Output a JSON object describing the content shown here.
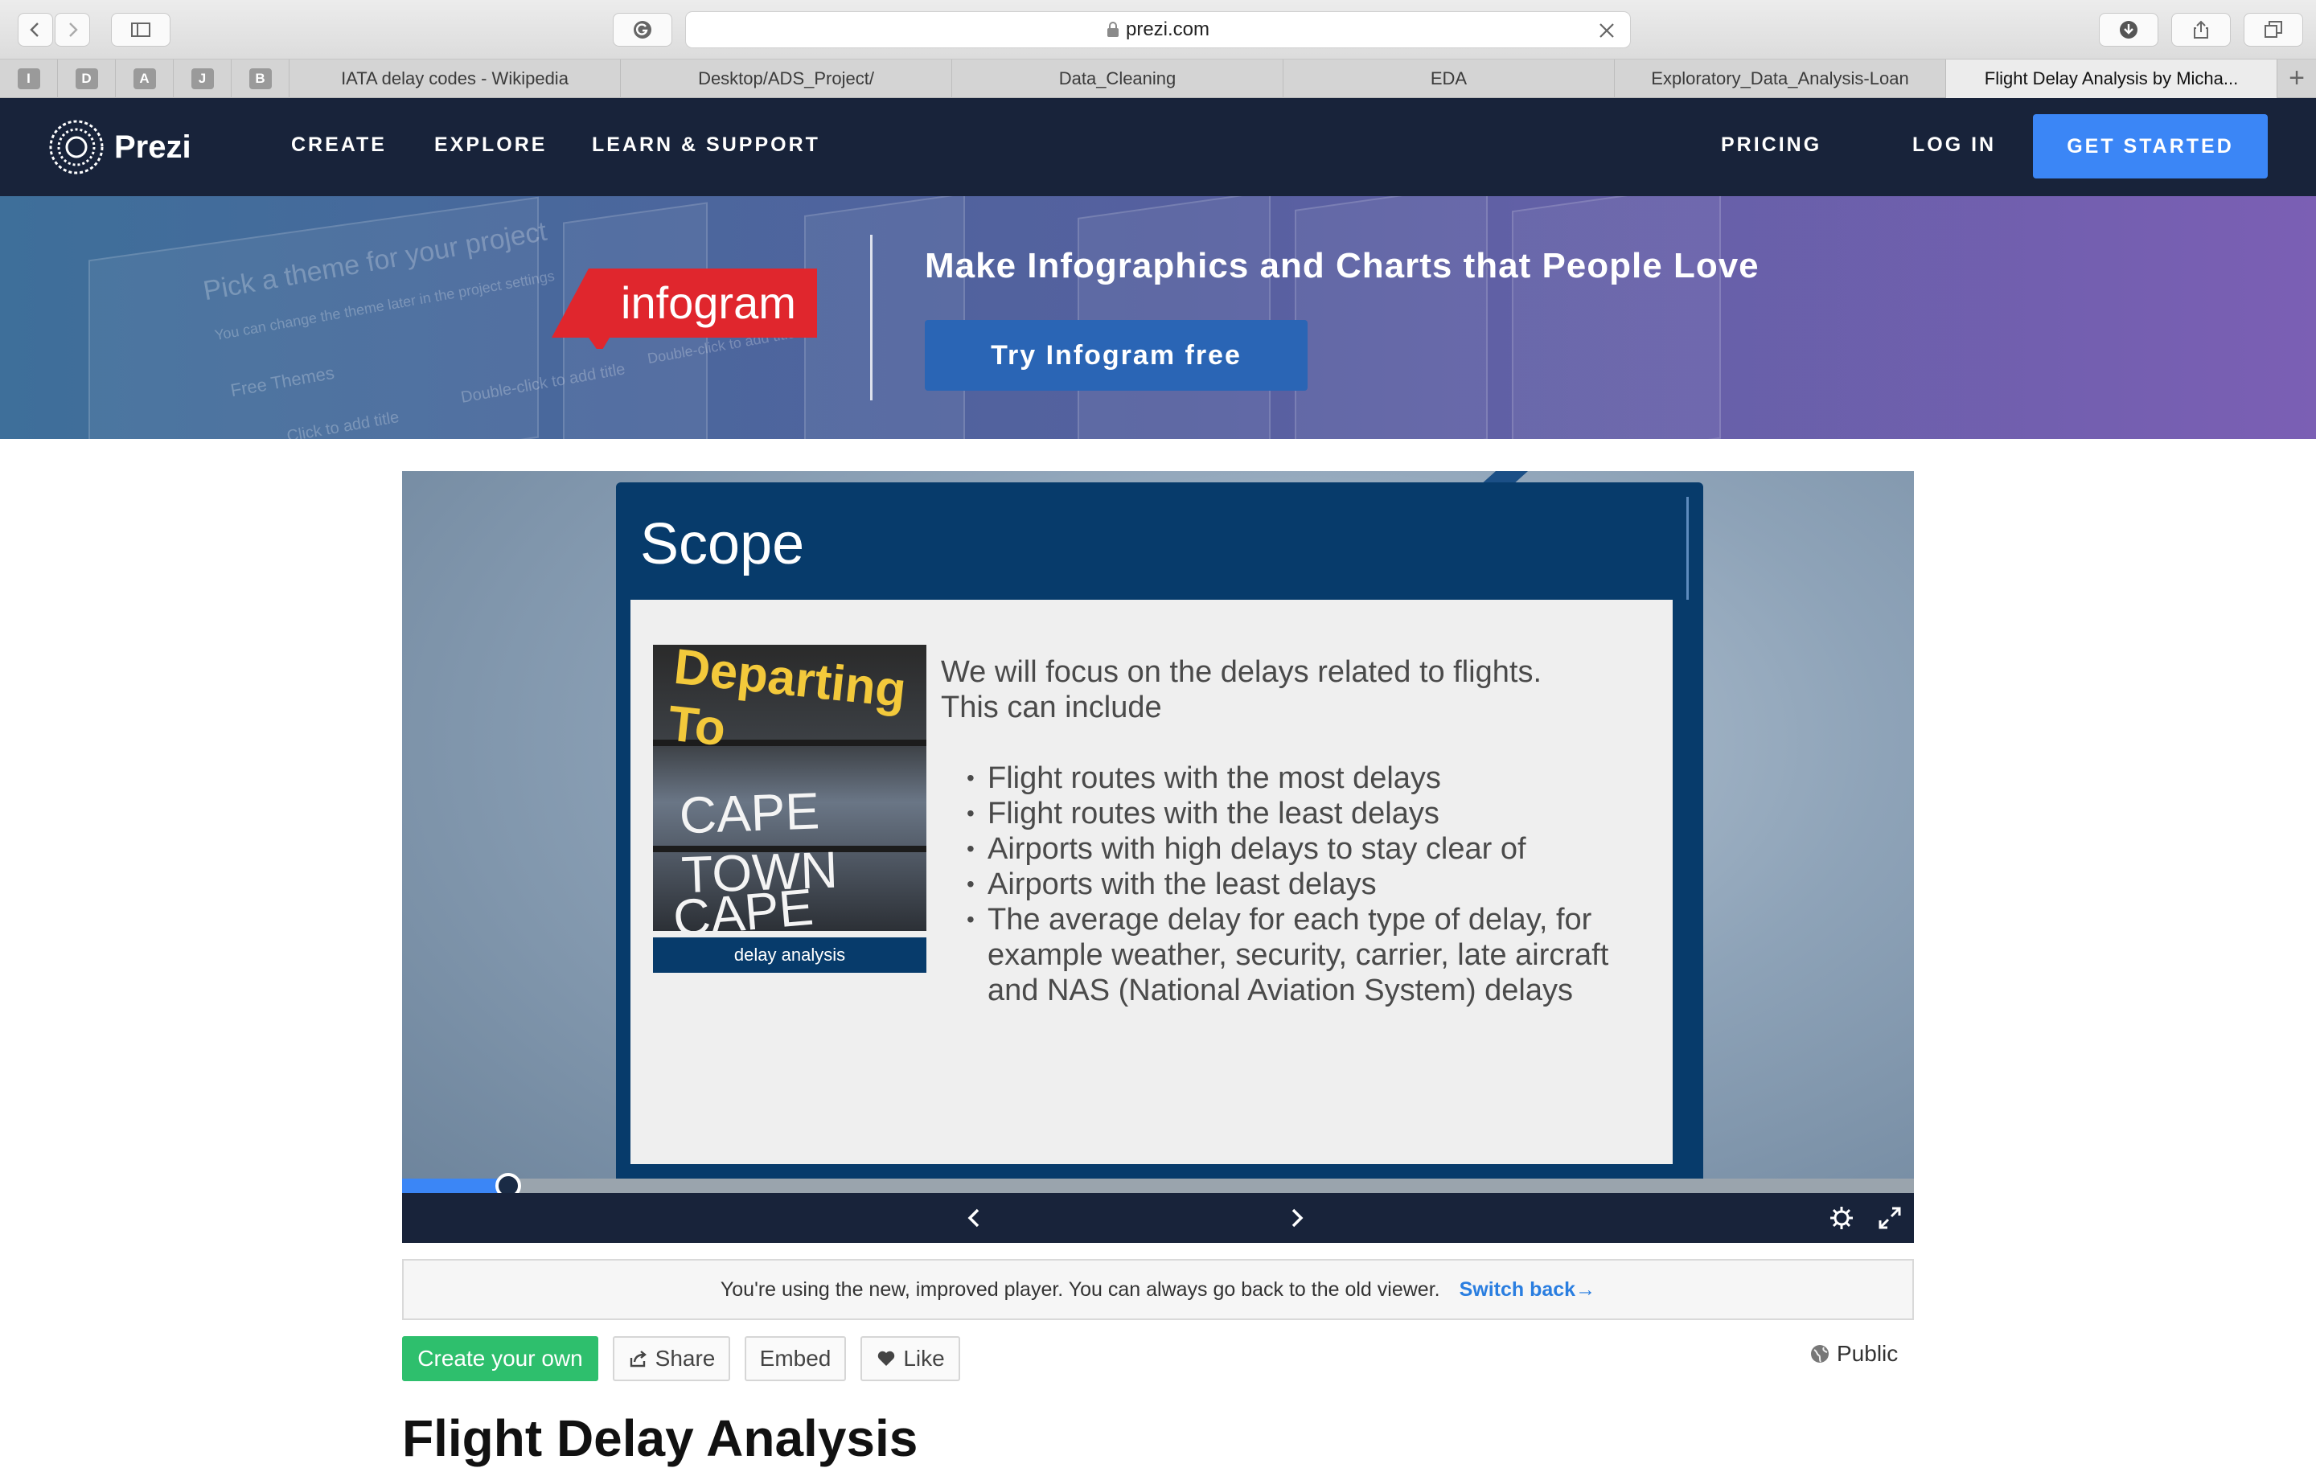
{
  "browser": {
    "url": "prezi.com",
    "pinned_tabs": [
      "I",
      "D",
      "A",
      "J",
      "B"
    ],
    "tabs": [
      {
        "label": "IATA delay codes - Wikipedia"
      },
      {
        "label": "Desktop/ADS_Project/"
      },
      {
        "label": "Data_Cleaning"
      },
      {
        "label": "EDA"
      },
      {
        "label": "Exploratory_Data_Analysis-Loan"
      },
      {
        "label": "Flight Delay Analysis by Micha..."
      }
    ],
    "new_tab": "+"
  },
  "nav": {
    "brand": "Prezi",
    "links": [
      "CREATE",
      "EXPLORE",
      "LEARN & SUPPORT"
    ],
    "pricing": "PRICING",
    "login": "LOG IN",
    "cta": "GET STARTED"
  },
  "banner": {
    "badge": "infogram",
    "headline": "Make Infographics and Charts that People Love",
    "button": "Try Infogram free",
    "bg_text": [
      "Pick a theme for your project",
      "You can change the theme later in the project settings",
      "Free Themes",
      "Double-click to add title",
      "Double-click to add title",
      "Click to add title"
    ]
  },
  "slide": {
    "title": "Scope",
    "image_text": [
      "Departing To",
      "CAPE TOWN",
      "CAPE TOWN"
    ],
    "image_caption": "delay analysis",
    "intro_line1": "We will focus on the delays related to flights.",
    "intro_line2": "This can include",
    "bullets": [
      "Flight routes with the most delays",
      "Flight routes with the least delays",
      "Airports with high delays to stay clear of",
      "Airports with the least delays",
      "The average delay for each type of delay, for example weather, security, carrier, late aircraft and NAS (National Aviation System) delays"
    ]
  },
  "player": {
    "progress_fraction": 0.07,
    "accent": "#3b86f6"
  },
  "notice": {
    "text": "You're using the new, improved player. You can always go back to the old viewer.",
    "link": "Switch back→"
  },
  "actions": {
    "create": "Create your own",
    "share": "Share",
    "embed": "Embed",
    "like": "Like",
    "visibility": "Public"
  },
  "page_title": "Flight Delay Analysis",
  "colors": {
    "nav_bg": "#18233a",
    "cta": "#3b86f6",
    "slide_blue": "#073b6b",
    "create_green": "#2ebf6d",
    "infogram_red": "#e0262d"
  }
}
